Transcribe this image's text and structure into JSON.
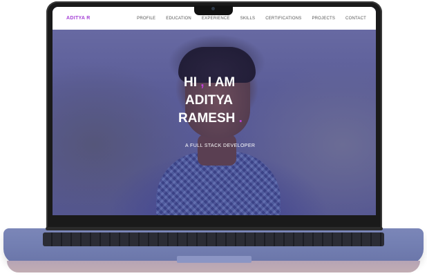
{
  "nav": {
    "brand": "ADITYA R",
    "links": [
      {
        "label": "PROFILE"
      },
      {
        "label": "EDUCATION"
      },
      {
        "label": "EXPERIENCE"
      },
      {
        "label": "SKILLS"
      },
      {
        "label": "CERTIFICATIONS"
      },
      {
        "label": "PROJECTS"
      },
      {
        "label": "CONTACT"
      }
    ]
  },
  "hero": {
    "greeting_hi": "HI",
    "greeting_comma": ",",
    "greeting_iam": "I AM",
    "first_name": "ADITYA",
    "last_name": "RAMESH",
    "dot": ".",
    "subtitle": "A FULL STACK DEVELOPER"
  },
  "colors": {
    "accent": "#c040d8",
    "brand": "#a43fd6",
    "overlay": "#5a5c96"
  }
}
